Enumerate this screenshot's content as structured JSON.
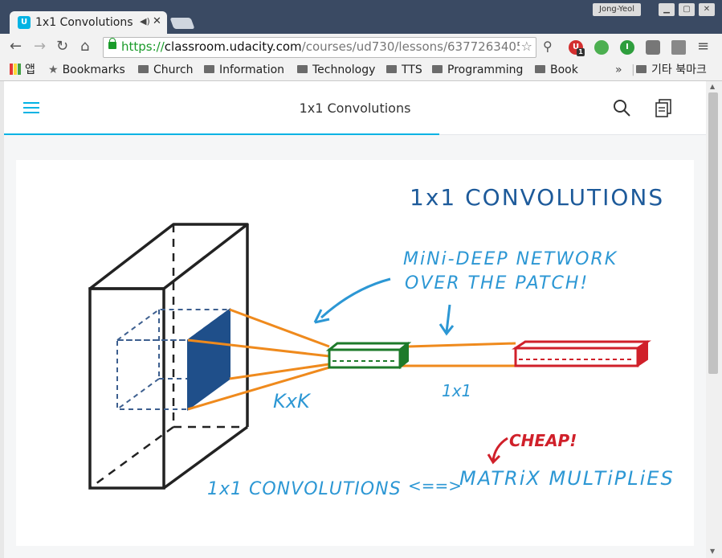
{
  "browser": {
    "tab_title": "1x1 Convolutions",
    "tab_favicon": "U",
    "window_user": "Jong-Yeol",
    "url_scheme": "https://",
    "url_host": "classroom.udacity.com",
    "url_path": "/courses/ud730/lessons/6377263405/c",
    "bookmarks": [
      "앱",
      "Bookmarks",
      "Church",
      "Information",
      "Technology",
      "TTS",
      "Programming",
      "Book"
    ],
    "overflow": "»",
    "other_bookmarks": "기타 북마크",
    "extension_badge": "1"
  },
  "page": {
    "lesson_title": "1x1 Convolutions",
    "progress_fraction": 0.62
  },
  "slide": {
    "title": "1x1 CONVOLUTIONS",
    "annotation_line1": "MiNi-DEEP NETWORK",
    "annotation_line2": "OVER THE PATCH!",
    "label_kxk": "KxK",
    "label_1x1": "1x1",
    "cheap": "CHEAP!",
    "bottom_left": "1x1 CONVOLUTIONS",
    "arrow": "<==>",
    "bottom_right": "MATRiX MULTiPLiES"
  },
  "colors": {
    "accent": "#02b3e4",
    "hand_blue": "#2c97d4",
    "hand_navy": "#1d5a9a",
    "orange": "#ef8a1d",
    "green": "#1d7a2a",
    "red": "#d0202a",
    "patch": "#1f4f8a"
  }
}
